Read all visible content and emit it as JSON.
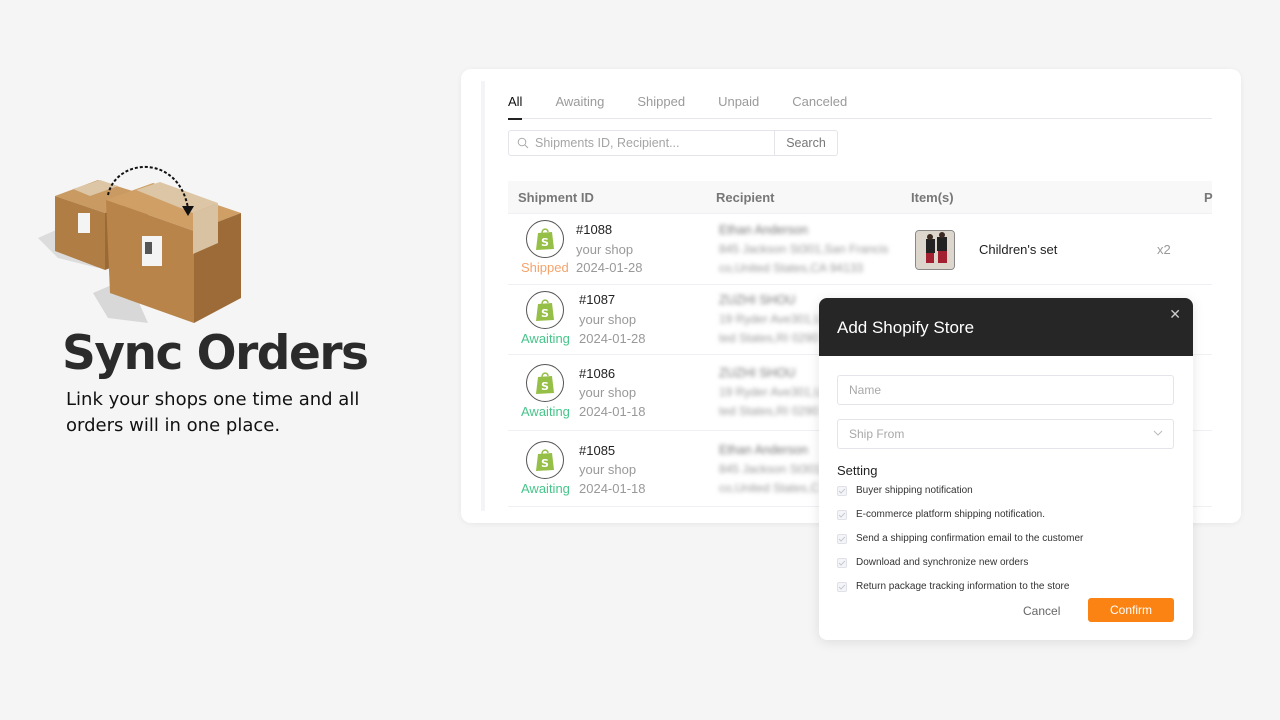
{
  "hero": {
    "title": "Sync Orders",
    "subtitle": "Link your shops one time and all orders will in one place.",
    "illustration": "two-cardboard-boxes-with-sync-arrow"
  },
  "tabs": [
    {
      "label": "All",
      "active": true
    },
    {
      "label": "Awaiting",
      "active": false
    },
    {
      "label": "Shipped",
      "active": false
    },
    {
      "label": "Unpaid",
      "active": false
    },
    {
      "label": "Canceled",
      "active": false
    }
  ],
  "search": {
    "placeholder": "Shipments ID, Recipient...",
    "value": "",
    "button_label": "Search",
    "icon": "search-icon"
  },
  "table": {
    "columns": [
      "Shipment ID",
      "Recipient",
      "Item(s)",
      "P"
    ],
    "rows": [
      {
        "icon": "shopify-icon",
        "status": "Shipped",
        "id": "#1088",
        "shop": "your shop",
        "date": "2024-01-28",
        "recipient_name": "Ethan Anderson",
        "recipient_addr1": "845 Jackson St301,San Francis",
        "recipient_addr2": "co,United States,CA 94133",
        "item_name": "Children's set",
        "item_qty": "x2"
      },
      {
        "icon": "shopify-icon",
        "status": "Awaiting",
        "id": "#1087",
        "shop": "your shop",
        "date": "2024-01-28",
        "recipient_name": "ZUZHI SHOU",
        "recipient_addr1": "19 Ryder Ave301,U",
        "recipient_addr2": "ted States,RI 0290"
      },
      {
        "icon": "shopify-icon",
        "status": "Awaiting",
        "id": "#1086",
        "shop": "your shop",
        "date": "2024-01-18",
        "recipient_name": "ZUZHI SHOU",
        "recipient_addr1": "19 Ryder Ave301,U",
        "recipient_addr2": "ted States,RI 0290"
      },
      {
        "icon": "shopify-icon",
        "status": "Awaiting",
        "id": "#1085",
        "shop": "your shop",
        "date": "2024-01-18",
        "recipient_name": "Ethan Anderson",
        "recipient_addr1": "845 Jackson St301",
        "recipient_addr2": "co,United States,C"
      }
    ]
  },
  "modal": {
    "title": "Add Shopify Store",
    "close_icon": "close-icon",
    "name_placeholder": "Name",
    "ship_from_placeholder": "Ship From",
    "setting_label": "Setting",
    "options": [
      {
        "label": "Buyer shipping notification",
        "checked": true
      },
      {
        "label": "E-commerce platform shipping notification.",
        "checked": true
      },
      {
        "label": "Send a shipping confirmation email to the customer",
        "checked": true
      },
      {
        "label": "Download and synchronize new orders",
        "checked": true
      },
      {
        "label": "Return package tracking information to the store",
        "checked": true
      }
    ],
    "cancel_label": "Cancel",
    "confirm_label": "Confirm"
  },
  "colors": {
    "shipped": "#f5a36a",
    "awaiting": "#47c58a",
    "confirm": "#fb8314",
    "modal_header": "#262626",
    "shopify_green": "#95bf47"
  }
}
